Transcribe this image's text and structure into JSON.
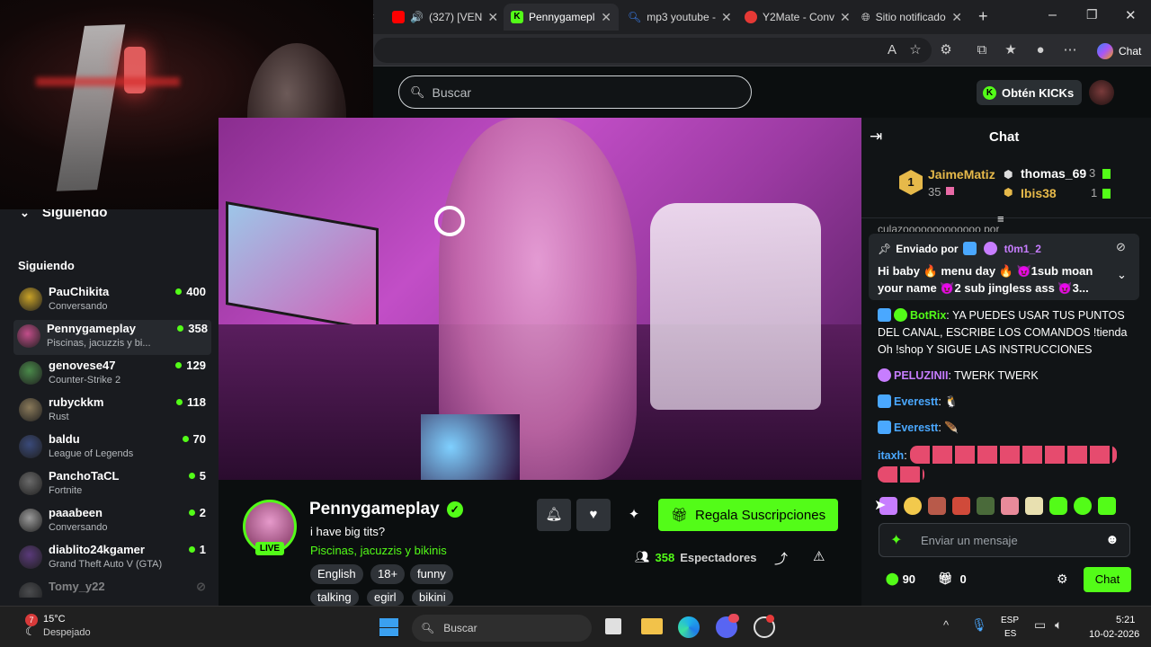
{
  "browser": {
    "tabs": [
      {
        "label": "(327) [VEN",
        "icon": "youtube-icon",
        "color": "#ff0000"
      },
      {
        "label": "Pennygameplay",
        "icon": "kick-icon",
        "color": "#53fc18",
        "active": true
      },
      {
        "label": "mp3 youtube -",
        "icon": "search-icon",
        "color": "#3b82f6"
      },
      {
        "label": "Y2Mate - Conv",
        "icon": "y2mate-icon",
        "color": "#e53935"
      },
      {
        "label": "Sitio notificado",
        "icon": "globe-icon",
        "color": "#cccccc"
      }
    ],
    "chat_button": "Chat"
  },
  "header": {
    "search_placeholder": "Buscar",
    "get_kicks": "Obtén KICKs"
  },
  "sidebar": {
    "collapse_label": "Siguiendo",
    "section_title": "Siguiendo",
    "items": [
      {
        "name": "PauChikita",
        "category": "Conversando",
        "viewers": "400",
        "color": "#c9a227"
      },
      {
        "name": "Pennygameplay",
        "category": "Piscinas, jacuzzis y bi...",
        "viewers": "358",
        "color": "#c24e8a"
      },
      {
        "name": "genovese47",
        "category": "Counter-Strike 2",
        "viewers": "129",
        "color": "#4a8a4a"
      },
      {
        "name": "rubyckkm",
        "category": "Rust",
        "viewers": "118",
        "color": "#8a7a5a"
      },
      {
        "name": "baldu",
        "category": "League of Legends",
        "viewers": "70",
        "color": "#3a4a7a"
      },
      {
        "name": "PanchoTaCL",
        "category": "Fortnite",
        "viewers": "5",
        "color": "#6a6a6a"
      },
      {
        "name": "paaabeen",
        "category": "Conversando",
        "viewers": "2",
        "color": "#9a9a9a"
      },
      {
        "name": "diablito24kgamer",
        "category": "Grand Theft Auto V (GTA)",
        "viewers": "1",
        "color": "#5a3a7a"
      },
      {
        "name": "Tomy_y22",
        "category": "",
        "viewers": "",
        "color": "#888888"
      }
    ]
  },
  "stream": {
    "channel": "Pennygameplay",
    "title": "i have big tits?",
    "category": "Piscinas, jacuzzis y bikinis",
    "live_label": "LIVE",
    "tags": [
      "English",
      "18+",
      "funny",
      "talking",
      "egirl",
      "bikini"
    ],
    "subscribe_label": "Regala Suscripciones",
    "viewers": "358",
    "viewers_label": "Espectadores"
  },
  "chat": {
    "title": "Chat",
    "leaderboard": [
      {
        "rank": "1",
        "name": "JaimeMatiz",
        "value": "35",
        "color": "#e6b94a"
      },
      {
        "rank": "",
        "name": "thomas_69",
        "value": "3",
        "color": "#ffffff"
      },
      {
        "rank": "",
        "name": "Ibis38",
        "value": "1",
        "color": "#e6b94a"
      }
    ],
    "cut_text": "culazooooooooooooo por",
    "pinned": {
      "label": "Enviado por",
      "author": "t0m1_2",
      "text": "Hi baby 🔥 menu day 🔥 😈1sub moan your name 😈2 sub jingless ass 😈3..."
    },
    "messages": [
      {
        "user": "BotRix",
        "color": "#53fc18",
        "text": "YA PUEDES USAR TUS PUNTOS DEL CANAL, ESCRIBE LOS COMANDOS !tienda Oh !shop Y SIGUE LAS INSTRUCCIONES"
      },
      {
        "user": "PELUZINII",
        "color": "#c77dff",
        "text": "TWERK TWERK"
      },
      {
        "user": "Everestt",
        "color": "#4aa8ff",
        "text": "🐧"
      },
      {
        "user": "Everestt",
        "color": "#4aa8ff",
        "text": "🪶"
      },
      {
        "user": "itaxh",
        "color": "#4aa8ff",
        "text": ""
      }
    ],
    "input_placeholder": "Enviar un mensaje",
    "points": "90",
    "gifts": "0",
    "send_label": "Chat"
  },
  "taskbar": {
    "weather_temp": "15°C",
    "weather_desc": "Despejado",
    "weather_badge": "7",
    "search_placeholder": "Buscar",
    "lang_top": "ESP",
    "lang_bottom": "ES",
    "time": "5:21",
    "date": "10-02-2026"
  }
}
